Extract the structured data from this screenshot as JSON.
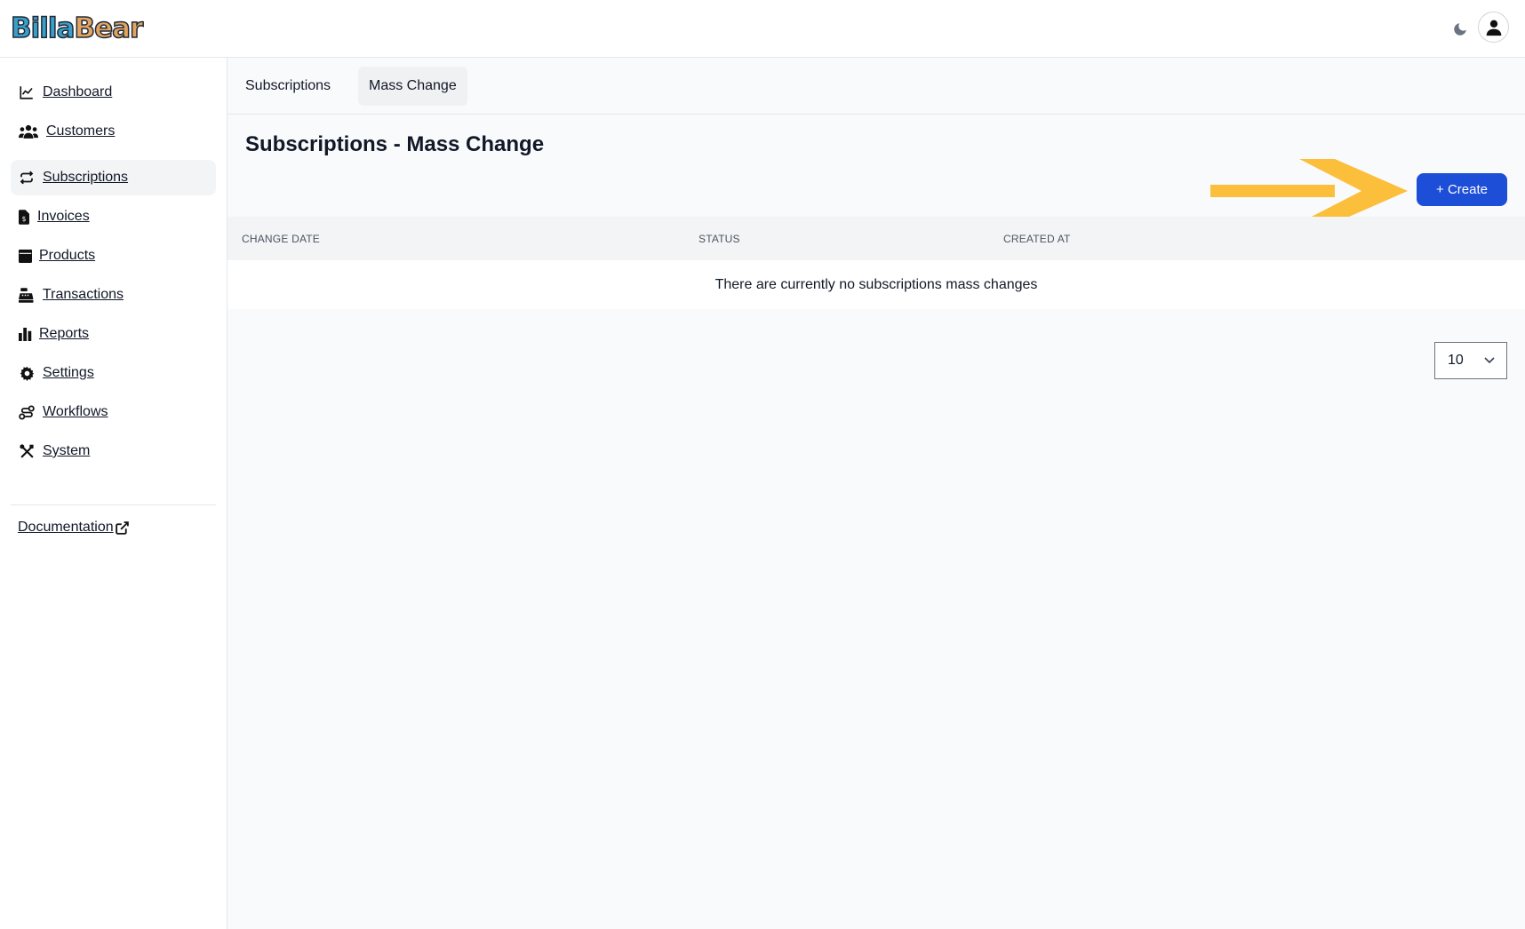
{
  "app": {
    "logo_part1": "Billa",
    "logo_part2": "Bear"
  },
  "header": {
    "theme_toggle_icon": "moon-icon",
    "avatar_icon": "user-icon"
  },
  "sidebar": {
    "items": [
      {
        "label": "Dashboard",
        "icon": "chart-line-icon"
      },
      {
        "label": "Customers",
        "icon": "users-icon"
      },
      {
        "label": "Subscriptions",
        "icon": "repeat-icon",
        "active": true
      },
      {
        "label": "Invoices",
        "icon": "file-invoice-icon"
      },
      {
        "label": "Products",
        "icon": "box-icon"
      },
      {
        "label": "Transactions",
        "icon": "cash-register-icon"
      },
      {
        "label": "Reports",
        "icon": "bar-chart-icon"
      },
      {
        "label": "Settings",
        "icon": "gear-icon"
      },
      {
        "label": "Workflows",
        "icon": "workflow-icon"
      },
      {
        "label": "System",
        "icon": "tools-icon"
      }
    ],
    "documentation_label": "Documentation",
    "documentation_icon": "external-link-icon"
  },
  "main": {
    "tabs": [
      {
        "label": "Subscriptions"
      },
      {
        "label": "Mass Change",
        "active": true
      }
    ],
    "title": "Subscriptions - Mass Change",
    "create_label": "+ Create",
    "table": {
      "columns": [
        "CHANGE DATE",
        "STATUS",
        "CREATED AT"
      ],
      "empty_message": "There are currently no subscriptions mass changes"
    },
    "per_page": "10"
  },
  "colors": {
    "primary": "#1d4ed8",
    "arrow": "#fbbf3c"
  }
}
